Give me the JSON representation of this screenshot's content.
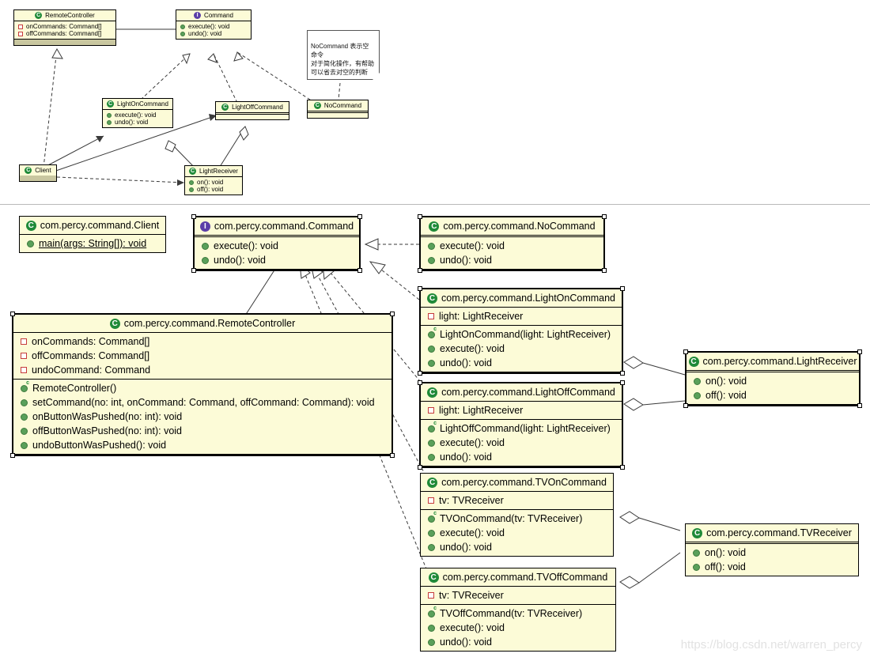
{
  "watermark": "https://blog.csdn.net/warren_percy",
  "note": {
    "text": "NoCommand 表示空命令\n对于简化操作，有帮助\n可以省去对空的判断"
  },
  "overview": {
    "remote_controller": {
      "name": "RemoteController",
      "icon": "class-icon",
      "fields": [
        "onCommands: Command[]",
        "offCommands: Command[]"
      ]
    },
    "command": {
      "name": "Command",
      "icon": "interface-icon",
      "methods": [
        "execute(): void",
        "undo(): void"
      ]
    },
    "light_on_command": {
      "name": "LightOnCommand",
      "icon": "class-icon",
      "methods": [
        "execute(): void",
        "undo(): void"
      ]
    },
    "light_off_command": {
      "name": "LightOffCommand",
      "icon": "class-icon"
    },
    "no_command": {
      "name": "NoCommand",
      "icon": "class-icon"
    },
    "client": {
      "name": "Client",
      "icon": "class-icon"
    },
    "light_receiver": {
      "name": "LightReceiver",
      "icon": "class-icon",
      "methods": [
        "on(): void",
        "off(): void"
      ]
    }
  },
  "classes": {
    "client": {
      "name": "com.percy.command.Client",
      "icon": "class-icon",
      "methods": [
        {
          "text": "main(args: String[]): void",
          "icon": "public-static-icon"
        }
      ]
    },
    "command": {
      "name": "com.percy.command.Command",
      "icon": "interface-icon",
      "methods": [
        {
          "text": "execute(): void",
          "icon": "public-icon"
        },
        {
          "text": "undo(): void",
          "icon": "public-icon"
        }
      ]
    },
    "no_command": {
      "name": "com.percy.command.NoCommand",
      "icon": "class-icon",
      "methods": [
        {
          "text": "execute(): void",
          "icon": "public-icon"
        },
        {
          "text": "undo(): void",
          "icon": "public-icon"
        }
      ]
    },
    "remote_controller": {
      "name": "com.percy.command.RemoteController",
      "icon": "class-icon",
      "fields": [
        {
          "text": "onCommands: Command[]",
          "icon": "private-icon"
        },
        {
          "text": "offCommands: Command[]",
          "icon": "private-icon"
        },
        {
          "text": "undoCommand: Command",
          "icon": "private-icon"
        }
      ],
      "methods": [
        {
          "text": "RemoteController()",
          "icon": "constructor-icon"
        },
        {
          "text": "setCommand(no: int, onCommand: Command, offCommand: Command): void",
          "icon": "public-icon"
        },
        {
          "text": "onButtonWasPushed(no: int): void",
          "icon": "public-icon"
        },
        {
          "text": "offButtonWasPushed(no: int): void",
          "icon": "public-icon"
        },
        {
          "text": "undoButtonWasPushed(): void",
          "icon": "public-icon"
        }
      ]
    },
    "light_on_command": {
      "name": "com.percy.command.LightOnCommand",
      "icon": "class-icon",
      "fields": [
        {
          "text": "light: LightReceiver",
          "icon": "private-icon"
        }
      ],
      "methods": [
        {
          "text": "LightOnCommand(light: LightReceiver)",
          "icon": "constructor-icon"
        },
        {
          "text": "execute(): void",
          "icon": "public-icon"
        },
        {
          "text": "undo(): void",
          "icon": "public-icon"
        }
      ]
    },
    "light_off_command": {
      "name": "com.percy.command.LightOffCommand",
      "icon": "class-icon",
      "fields": [
        {
          "text": "light: LightReceiver",
          "icon": "private-icon"
        }
      ],
      "methods": [
        {
          "text": "LightOffCommand(light: LightReceiver)",
          "icon": "constructor-icon"
        },
        {
          "text": "execute(): void",
          "icon": "public-icon"
        },
        {
          "text": "undo(): void",
          "icon": "public-icon"
        }
      ]
    },
    "tv_on_command": {
      "name": "com.percy.command.TVOnCommand",
      "icon": "class-icon",
      "fields": [
        {
          "text": "tv: TVReceiver",
          "icon": "private-icon"
        }
      ],
      "methods": [
        {
          "text": "TVOnCommand(tv: TVReceiver)",
          "icon": "constructor-icon"
        },
        {
          "text": "execute(): void",
          "icon": "public-icon"
        },
        {
          "text": "undo(): void",
          "icon": "public-icon"
        }
      ]
    },
    "tv_off_command": {
      "name": "com.percy.command.TVOffCommand",
      "icon": "class-icon",
      "fields": [
        {
          "text": "tv: TVReceiver",
          "icon": "private-icon"
        }
      ],
      "methods": [
        {
          "text": "TVOffCommand(tv: TVReceiver)",
          "icon": "constructor-icon"
        },
        {
          "text": "execute(): void",
          "icon": "public-icon"
        },
        {
          "text": "undo(): void",
          "icon": "public-icon"
        }
      ]
    },
    "light_receiver": {
      "name": "com.percy.command.LightReceiver",
      "icon": "class-icon",
      "methods": [
        {
          "text": "on(): void",
          "icon": "public-icon"
        },
        {
          "text": "off(): void",
          "icon": "public-icon"
        }
      ]
    },
    "tv_receiver": {
      "name": "com.percy.command.TVReceiver",
      "icon": "class-icon",
      "methods": [
        {
          "text": "on(): void",
          "icon": "public-icon"
        },
        {
          "text": "off(): void",
          "icon": "public-icon"
        }
      ]
    }
  },
  "icon_glyphs": {
    "class": "C",
    "interface": "I"
  }
}
